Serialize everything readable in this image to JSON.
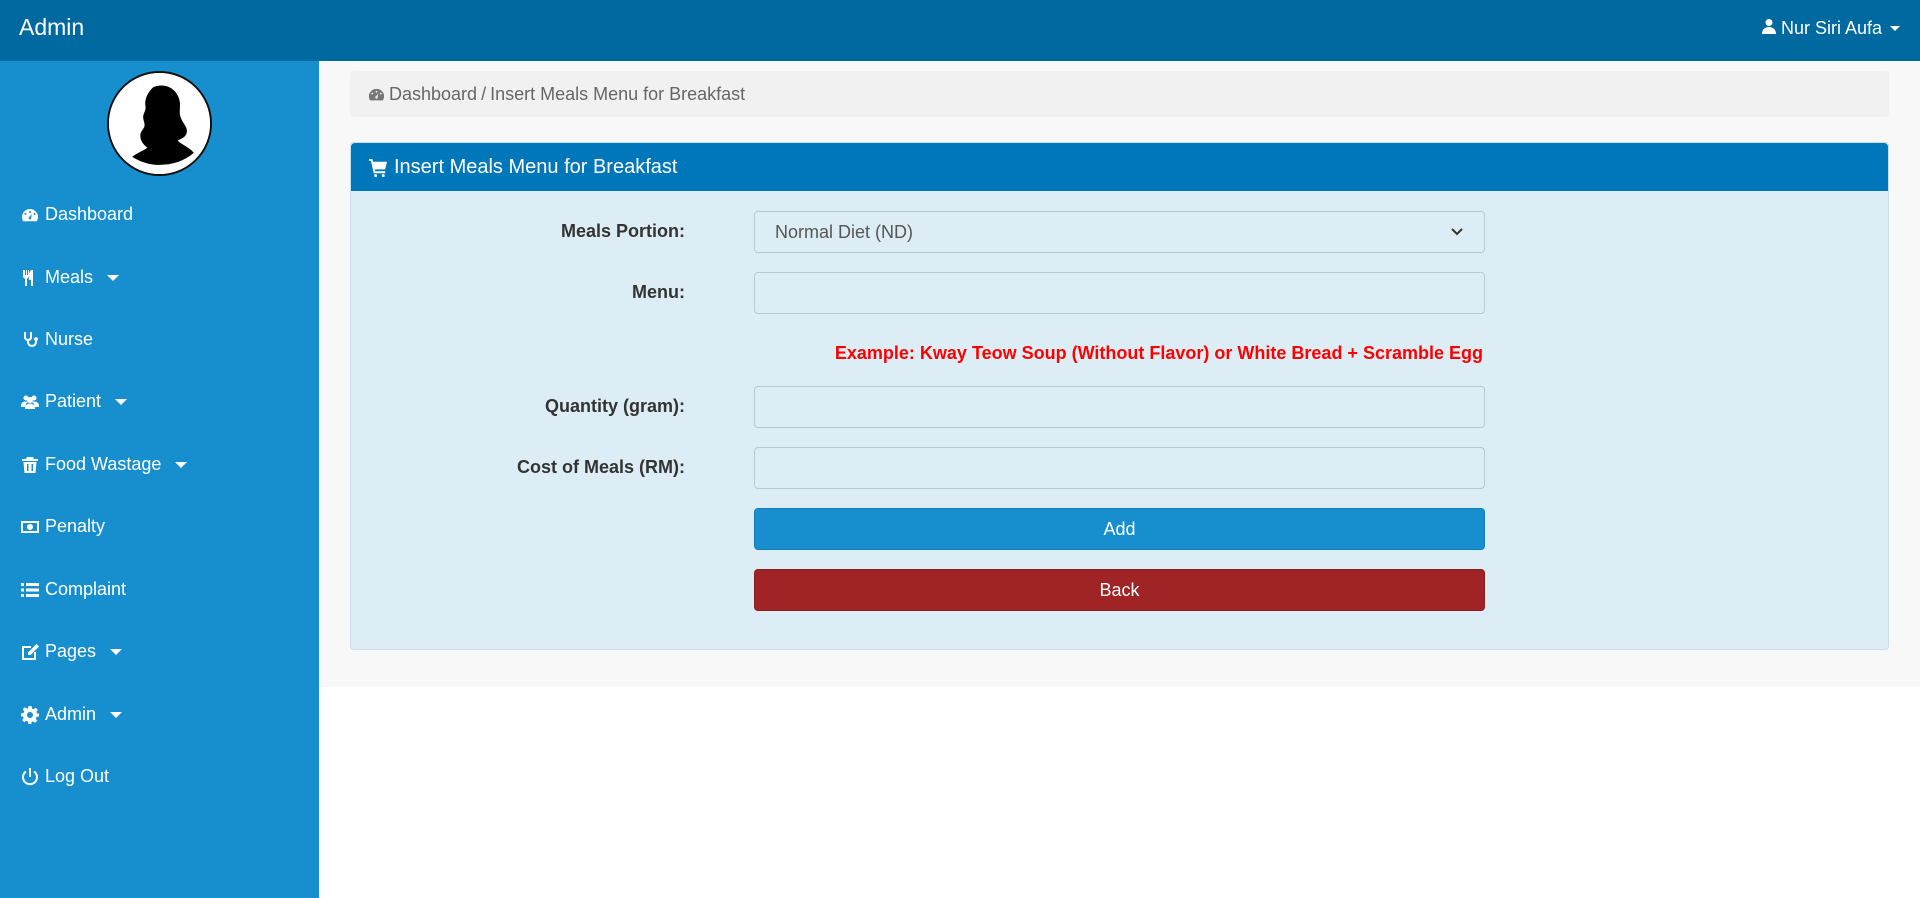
{
  "header": {
    "brand": "Admin",
    "user_name": "Nur Siri Aufa"
  },
  "sidebar": {
    "items": [
      {
        "label": "Dashboard",
        "icon": "dashboard-icon"
      },
      {
        "label": "Meals",
        "icon": "utensils-icon",
        "dropdown": true
      },
      {
        "label": "Nurse",
        "icon": "stethoscope-icon"
      },
      {
        "label": "Patient",
        "icon": "users-icon",
        "dropdown": true
      },
      {
        "label": "Food Wastage",
        "icon": "trash-icon",
        "dropdown": true
      },
      {
        "label": "Penalty",
        "icon": "money-icon"
      },
      {
        "label": "Complaint",
        "icon": "list-icon"
      },
      {
        "label": "Pages",
        "icon": "edit-icon",
        "dropdown": true
      },
      {
        "label": "Admin",
        "icon": "gear-icon",
        "dropdown": true
      },
      {
        "label": "Log Out",
        "icon": "power-icon"
      }
    ]
  },
  "breadcrumb": {
    "home": "Dashboard",
    "separator": "/",
    "current": "Insert Meals Menu for Breakfast"
  },
  "form": {
    "title": "Insert Meals Menu for Breakfast",
    "meals_portion_label": "Meals Portion:",
    "meals_portion_value": "Normal Diet (ND)",
    "menu_label": "Menu:",
    "menu_value": "",
    "example_text": "Example: Kway Teow Soup (Without Flavor) or White Bread + Scramble Egg",
    "quantity_label": "Quantity (gram):",
    "quantity_value": "",
    "cost_label": "Cost of Meals (RM):",
    "cost_value": "",
    "add_label": "Add",
    "back_label": "Back"
  },
  "colors": {
    "topbar": "#00699f",
    "sidebar": "#178fcf",
    "panel_header": "#0077bb",
    "add_button": "#178fcf",
    "back_button": "#a02325",
    "example_text": "#ff0000"
  }
}
